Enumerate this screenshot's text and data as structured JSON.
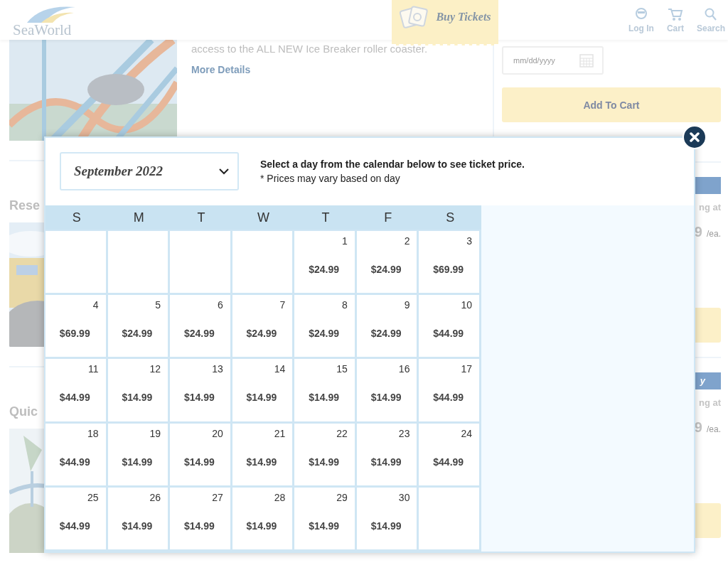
{
  "header": {
    "logo": "SeaWorld",
    "buy_tickets": "Buy Tickets",
    "nav": [
      {
        "label": "Log In",
        "kind": "login"
      },
      {
        "label": "Cart",
        "kind": "cart"
      },
      {
        "label": "Search",
        "kind": "search"
      }
    ]
  },
  "page": {
    "description": "access to the ALL NEW Ice Breaker roller coaster.",
    "more_details": "More Details",
    "date_field": {
      "placeholder": "mm/dd/yyyy"
    },
    "add_to_cart": "Add To Cart",
    "section_titles": [
      "Rese",
      "Quic"
    ],
    "offers": [
      {
        "note": "ng at",
        "price": "9",
        "unit": "/ea."
      },
      {
        "badge": "y",
        "note": "ng at",
        "price": "9",
        "unit": "/ea."
      }
    ]
  },
  "modal": {
    "month_select": "September 2022",
    "instruction": "Select a day from the calendar below to see ticket price.",
    "note": "* Prices may vary based on day",
    "weekdays": [
      "S",
      "M",
      "T",
      "W",
      "T",
      "F",
      "S"
    ],
    "weeks": [
      [
        {
          "kind": "empty"
        },
        {
          "kind": "empty"
        },
        {
          "kind": "empty"
        },
        {
          "kind": "empty"
        },
        {
          "kind": "day",
          "date": "1",
          "price": "$24.99"
        },
        {
          "kind": "day",
          "date": "2",
          "price": "$24.99"
        },
        {
          "kind": "day",
          "date": "3",
          "price": "$69.99"
        }
      ],
      [
        {
          "kind": "day",
          "date": "4",
          "price": "$69.99"
        },
        {
          "kind": "day",
          "date": "5",
          "price": "$24.99"
        },
        {
          "kind": "day",
          "date": "6",
          "price": "$24.99"
        },
        {
          "kind": "day",
          "date": "7",
          "price": "$24.99"
        },
        {
          "kind": "day",
          "date": "8",
          "price": "$24.99"
        },
        {
          "kind": "day",
          "date": "9",
          "price": "$24.99"
        },
        {
          "kind": "day",
          "date": "10",
          "price": "$44.99"
        }
      ],
      [
        {
          "kind": "day",
          "date": "11",
          "price": "$44.99"
        },
        {
          "kind": "day",
          "date": "12",
          "price": "$14.99"
        },
        {
          "kind": "day",
          "date": "13",
          "price": "$14.99"
        },
        {
          "kind": "day",
          "date": "14",
          "price": "$14.99"
        },
        {
          "kind": "day",
          "date": "15",
          "price": "$14.99"
        },
        {
          "kind": "day",
          "date": "16",
          "price": "$14.99"
        },
        {
          "kind": "day",
          "date": "17",
          "price": "$44.99"
        }
      ],
      [
        {
          "kind": "day",
          "date": "18",
          "price": "$44.99"
        },
        {
          "kind": "day",
          "date": "19",
          "price": "$14.99"
        },
        {
          "kind": "day",
          "date": "20",
          "price": "$14.99"
        },
        {
          "kind": "day",
          "date": "21",
          "price": "$14.99"
        },
        {
          "kind": "day",
          "date": "22",
          "price": "$14.99"
        },
        {
          "kind": "day",
          "date": "23",
          "price": "$14.99"
        },
        {
          "kind": "day",
          "date": "24",
          "price": "$44.99"
        }
      ],
      [
        {
          "kind": "day",
          "date": "25",
          "price": "$44.99"
        },
        {
          "kind": "day",
          "date": "26",
          "price": "$14.99"
        },
        {
          "kind": "day",
          "date": "27",
          "price": "$14.99"
        },
        {
          "kind": "day",
          "date": "28",
          "price": "$14.99"
        },
        {
          "kind": "day",
          "date": "29",
          "price": "$14.99"
        },
        {
          "kind": "day",
          "date": "30",
          "price": "$14.99"
        },
        {
          "kind": "empty"
        }
      ]
    ]
  }
}
